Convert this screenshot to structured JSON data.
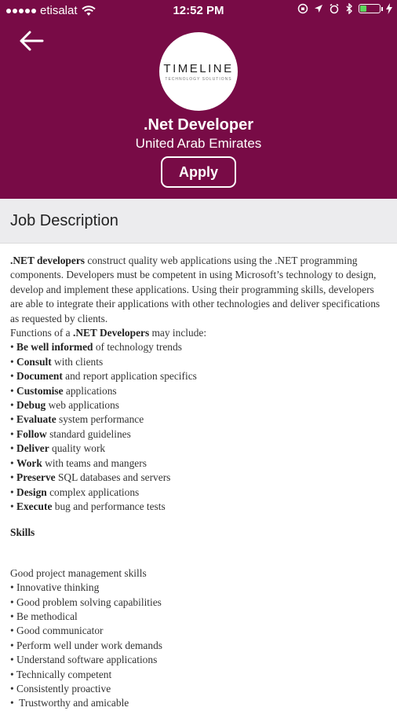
{
  "status_bar": {
    "carrier": "etisalat",
    "time": "12:52 PM"
  },
  "header": {
    "logo_text": "TIMELINE",
    "logo_subtext": "TECHNOLOGY SOLUTIONS",
    "job_title": ".Net Developer",
    "location": "United Arab Emirates",
    "apply_label": "Apply",
    "bg_color": "#780b46"
  },
  "section": {
    "title": "Job Description"
  },
  "description": {
    "intro_bold": ".NET developers",
    "intro_rest": " construct quality web applications using the .NET programming components. Developers must be competent in using Microsoft’s technology to design, develop and implement these applications. Using their programming skills, developers are able to integrate their applications with other technologies and deliver specifications as requested by clients.",
    "functions_prefix": "Functions of a ",
    "functions_bold": ".NET Developers",
    "functions_suffix": " may include:",
    "functions": [
      {
        "bold": "Be well informed",
        "rest": " of technology trends"
      },
      {
        "bold": "Consult",
        "rest": " with clients"
      },
      {
        "bold": "Document",
        "rest": " and report application specifics"
      },
      {
        "bold": "Customise",
        "rest": " applications"
      },
      {
        "bold": "Debug",
        "rest": " web applications"
      },
      {
        "bold": "Evaluate",
        "rest": " system performance"
      },
      {
        "bold": "Follow",
        "rest": " standard guidelines"
      },
      {
        "bold": "Deliver",
        "rest": " quality work"
      },
      {
        "bold": "Work",
        "rest": " with teams and mangers"
      },
      {
        "bold": "Preserve",
        "rest": " SQL databases and servers"
      },
      {
        "bold": "Design",
        "rest": " complex applications"
      },
      {
        "bold": "Execute",
        "rest": " bug and performance tests"
      }
    ],
    "skills_heading": "Skills",
    "skills_intro": "Good project management skills",
    "skills": [
      "Innovative thinking",
      "Good problem solving capabilities",
      "Be methodical",
      "Good communicator",
      "Perform well under work demands",
      "Understand software applications",
      "Technically competent",
      "Consistently proactive",
      " Trustworthy and amicable"
    ]
  }
}
